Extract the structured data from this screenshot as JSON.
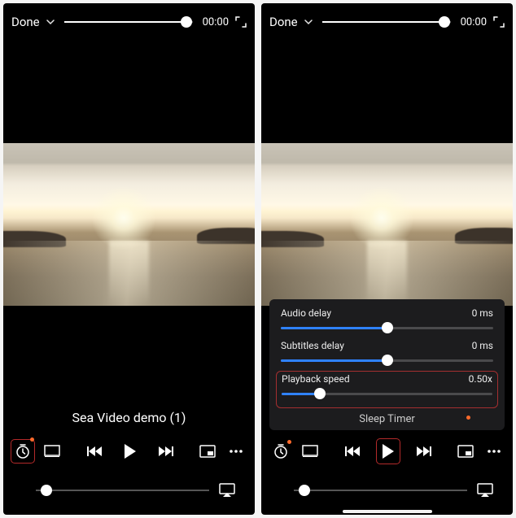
{
  "left": {
    "topbar": {
      "done_label": "Done",
      "time": "00:00",
      "progress_pct": 95
    },
    "video_title": "Sea Video demo (1)",
    "volume_pct": 6
  },
  "right": {
    "topbar": {
      "done_label": "Done",
      "time": "00:00",
      "progress_pct": 95
    },
    "panel": {
      "audio_delay_label": "Audio delay",
      "audio_delay_value": "0 ms",
      "audio_delay_pct": 50,
      "subtitles_delay_label": "Subtitles delay",
      "subtitles_delay_value": "0 ms",
      "subtitles_delay_pct": 50,
      "playback_speed_label": "Playback speed",
      "playback_speed_value": "0.50x",
      "playback_speed_pct": 18,
      "sleep_timer_label": "Sleep Timer"
    },
    "volume_pct": 6
  }
}
